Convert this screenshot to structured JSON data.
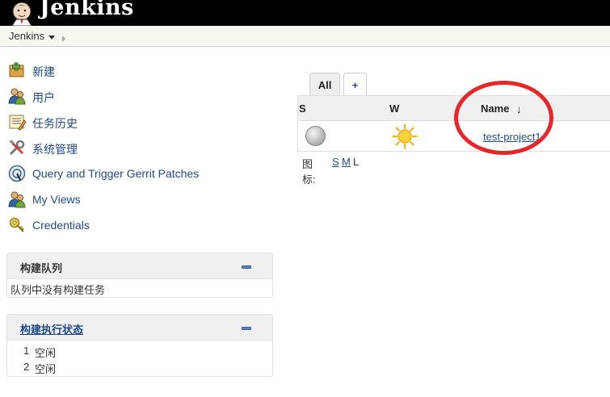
{
  "header": {
    "title": "Jenkins"
  },
  "breadcrumb": {
    "root": "Jenkins"
  },
  "sidebar": {
    "tasks": [
      {
        "label": "新建",
        "icon": "new-item-icon"
      },
      {
        "label": "用户",
        "icon": "users-icon"
      },
      {
        "label": "任务历史",
        "icon": "build-history-icon"
      },
      {
        "label": "系统管理",
        "icon": "manage-jenkins-icon"
      },
      {
        "label": "Query and Trigger Gerrit Patches",
        "icon": "gerrit-icon"
      },
      {
        "label": "My Views",
        "icon": "my-views-icon"
      },
      {
        "label": "Credentials",
        "icon": "credentials-icon"
      }
    ]
  },
  "build_queue": {
    "title": "构建队列",
    "empty_message": "队列中没有构建任务"
  },
  "executors": {
    "title": "构建执行状态",
    "rows": [
      {
        "num": "1",
        "status": "空闲"
      },
      {
        "num": "2",
        "status": "空闲"
      }
    ]
  },
  "view_tabs": {
    "all": "All",
    "add": "+"
  },
  "projects_table": {
    "columns": {
      "status": "S",
      "weather": "W",
      "name": "Name"
    },
    "sort_indicator": "↓",
    "rows": [
      {
        "name": "test-project1",
        "status_icon": "grey-ball-icon",
        "weather_icon": "sunny-icon"
      }
    ]
  },
  "icon_legend": {
    "label": "图标:",
    "sizes": [
      "S",
      "M",
      "L"
    ]
  },
  "colors": {
    "annotation": "#e8262a",
    "link": "#204a87",
    "header": "#000000"
  }
}
